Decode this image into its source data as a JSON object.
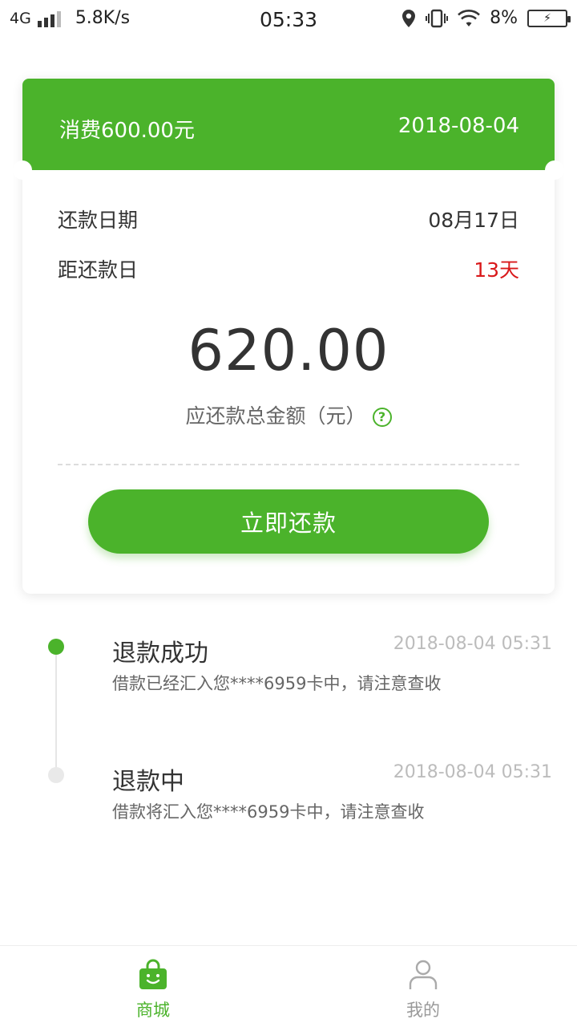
{
  "status_bar": {
    "network": "4G",
    "speed": "5.8K/s",
    "time": "05:33",
    "battery": "8%",
    "icons": [
      "signal-icon",
      "location-icon",
      "vibrate-icon",
      "wifi-icon",
      "battery-charging-icon"
    ]
  },
  "card": {
    "header_title": "消费600.00元",
    "header_date": "2018-08-04",
    "repay_date_label": "还款日期",
    "repay_date_value": "08月17日",
    "days_left_label": "距还款日",
    "days_left_value": "13天",
    "amount": "620.00",
    "amount_label": "应还款总金额（元）",
    "help_icon": "question-circle-icon",
    "repay_button": "立即还款"
  },
  "timeline": [
    {
      "title": "退款成功",
      "time": "2018-08-04 05:31",
      "desc": "借款已经汇入您****6959卡中，请注意查收",
      "active": true
    },
    {
      "title": "退款中",
      "time": "2018-08-04 05:31",
      "desc": "借款将汇入您****6959卡中，请注意查收",
      "active": false
    }
  ],
  "tabbar": {
    "tabs": [
      {
        "label": "商城",
        "icon": "shop-bag-icon",
        "active": true
      },
      {
        "label": "我的",
        "icon": "user-icon",
        "active": false
      }
    ]
  },
  "colors": {
    "accent": "#4bb32b",
    "warning": "#d9191b",
    "muted": "#bcbcbc"
  }
}
